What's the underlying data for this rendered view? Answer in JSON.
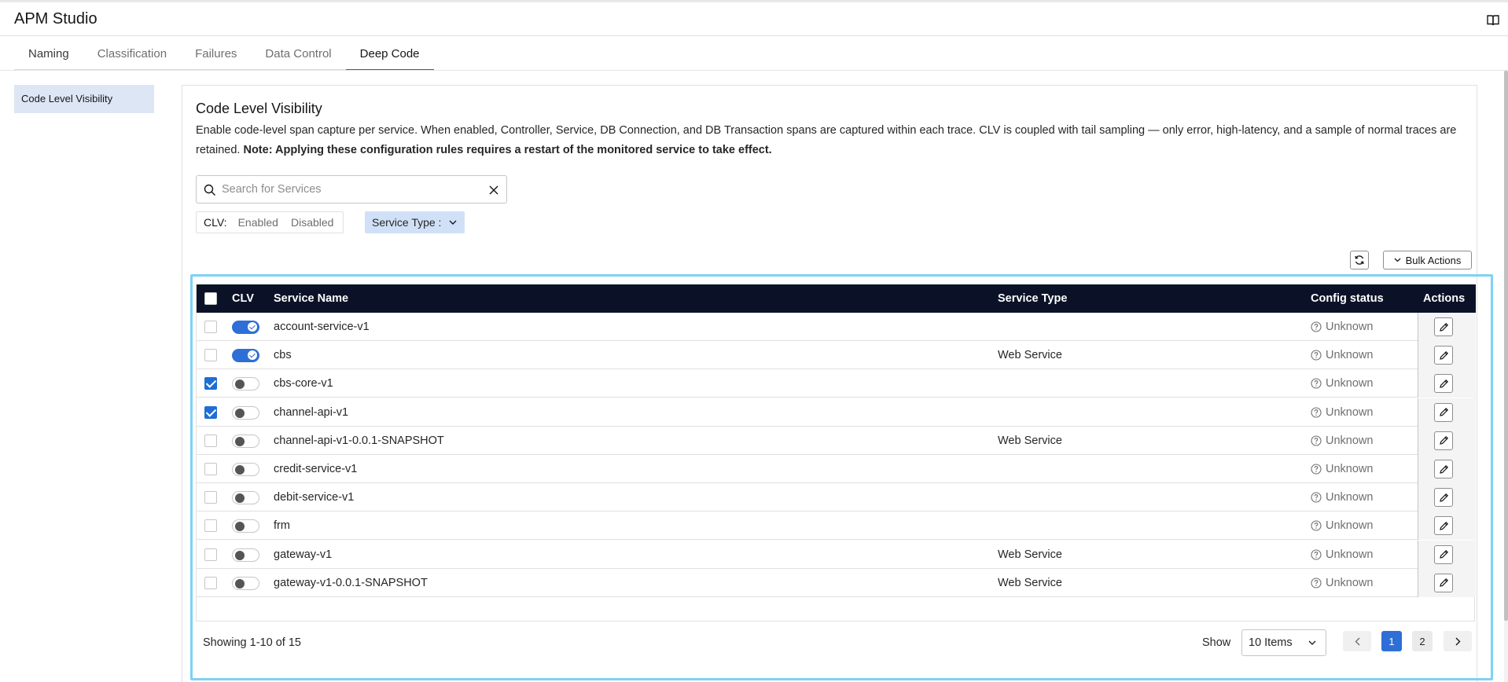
{
  "app": {
    "title": "APM Studio"
  },
  "tabs": [
    {
      "label": "Naming"
    },
    {
      "label": "Classification"
    },
    {
      "label": "Failures"
    },
    {
      "label": "Data Control"
    },
    {
      "label": "Deep Code",
      "active": true
    }
  ],
  "sidenav": {
    "items": [
      {
        "label": "Code Level Visibility",
        "active": true
      }
    ]
  },
  "panel": {
    "title": "Code Level Visibility",
    "description": "Enable code-level span capture per service. When enabled, Controller, Service, DB Connection, and DB Transaction spans are captured within each trace. CLV is coupled with tail sampling — only error, high-latency, and a sample of normal traces are retained.",
    "note": "Note: Applying these configuration rules requires a restart of the monitored service to take effect."
  },
  "search": {
    "placeholder": "Search for Services",
    "value": ""
  },
  "filters": {
    "clv_label": "CLV:",
    "clv_enabled": "Enabled",
    "clv_disabled": "Disabled",
    "service_type": "Service Type :"
  },
  "toolbar": {
    "bulk_actions": "Bulk Actions"
  },
  "table": {
    "headers": {
      "clv": "CLV",
      "service_name": "Service Name",
      "service_type": "Service Type",
      "config_status": "Config status",
      "actions": "Actions"
    },
    "rows": [
      {
        "selected": false,
        "clv": true,
        "name": "account-service-v1",
        "type": "",
        "status": "Unknown"
      },
      {
        "selected": false,
        "clv": true,
        "name": "cbs",
        "type": "Web Service",
        "status": "Unknown"
      },
      {
        "selected": true,
        "clv": false,
        "name": "cbs-core-v1",
        "type": "",
        "status": "Unknown"
      },
      {
        "selected": true,
        "clv": false,
        "name": "channel-api-v1",
        "type": "",
        "status": "Unknown"
      },
      {
        "selected": false,
        "clv": false,
        "name": "channel-api-v1-0.0.1-SNAPSHOT",
        "type": "Web Service",
        "status": "Unknown"
      },
      {
        "selected": false,
        "clv": false,
        "name": "credit-service-v1",
        "type": "",
        "status": "Unknown"
      },
      {
        "selected": false,
        "clv": false,
        "name": "debit-service-v1",
        "type": "",
        "status": "Unknown"
      },
      {
        "selected": false,
        "clv": false,
        "name": "frm",
        "type": "",
        "status": "Unknown"
      },
      {
        "selected": false,
        "clv": false,
        "name": "gateway-v1",
        "type": "Web Service",
        "status": "Unknown"
      },
      {
        "selected": false,
        "clv": false,
        "name": "gateway-v1-0.0.1-SNAPSHOT",
        "type": "Web Service",
        "status": "Unknown"
      }
    ]
  },
  "footer": {
    "showing": "Showing 1-10 of 15",
    "show_label": "Show",
    "items_per_page": "10 Items",
    "pages": [
      "1",
      "2"
    ],
    "current_page": "1"
  },
  "colors": {
    "accent": "#2d6fd6",
    "header_bg": "#0b1228",
    "highlight": "#7dd2f5"
  },
  "icons": {
    "help": "book-open-icon",
    "search": "search-icon",
    "clear": "close-icon",
    "refresh": "refresh-icon",
    "edit": "pencil-icon",
    "status": "question-circle-icon"
  }
}
